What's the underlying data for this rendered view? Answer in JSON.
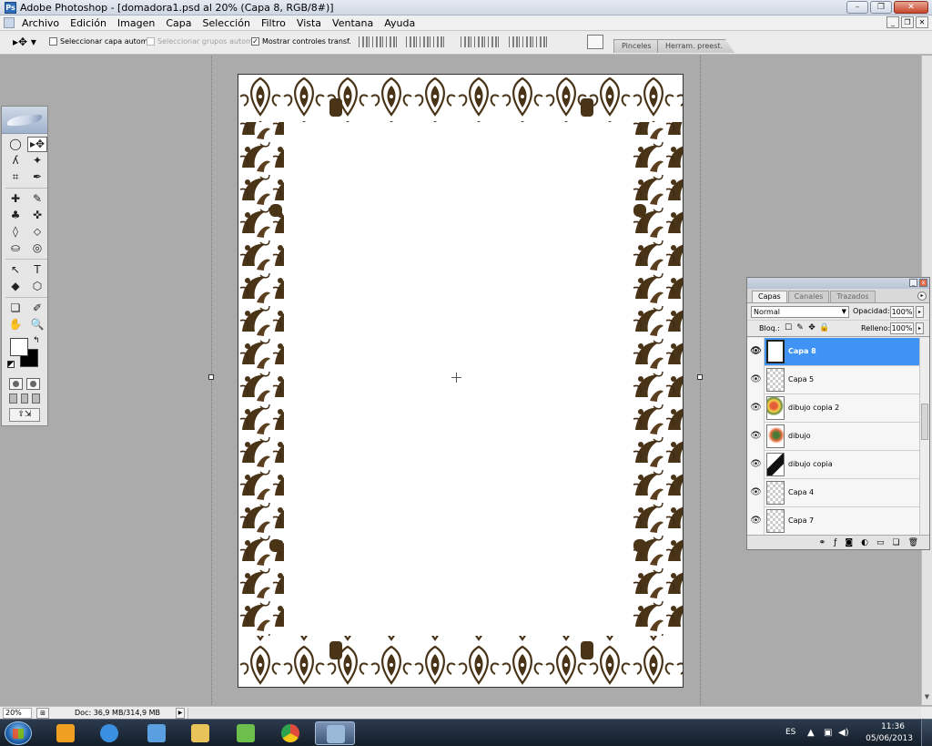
{
  "window": {
    "title": "Adobe Photoshop - [domadora1.psd al 20% (Capa 8, RGB/8#)]",
    "app_icon": "Ps",
    "controls": {
      "minimize": "–",
      "maximize": "❐",
      "close": "✕"
    }
  },
  "menubar": {
    "items": [
      "Archivo",
      "Edición",
      "Imagen",
      "Capa",
      "Selección",
      "Filtro",
      "Vista",
      "Ventana",
      "Ayuda"
    ],
    "doc_controls": {
      "minimize": "_",
      "restore": "❐",
      "close": "✕"
    }
  },
  "options_bar": {
    "tool_glyph": "▸✥ ▾",
    "auto_select_layer": {
      "label": "Seleccionar capa autom.",
      "checked": false
    },
    "auto_select_groups": {
      "label": "Seleccionar grupos autom.",
      "checked": false,
      "disabled": true
    },
    "show_transform_controls": {
      "label": "Mostrar controles transf.",
      "checked": true,
      "mark": "✓"
    },
    "palette_tabs": [
      "Pinceles",
      "Herram. preest."
    ]
  },
  "toolbox": {
    "tools": [
      "◯",
      "▸✥",
      "ʎ",
      "✦",
      "⌗",
      "✒",
      "✚",
      "✎",
      "♣",
      "✜",
      "◊",
      "⬦",
      "⛀",
      "◎",
      "↖",
      "T",
      "◆",
      "⬡",
      "❏",
      "✐",
      "✋",
      "🔍"
    ],
    "swap_glyph": "↰",
    "jump_label": "⇪⇲"
  },
  "layers_panel": {
    "tabs": [
      "Capas",
      "Canales",
      "Trazados"
    ],
    "blend_mode": "Normal",
    "opacity_label": "Opacidad:",
    "opacity": "100%",
    "lock_label": "Bloq.:",
    "lock_icons": [
      "☐",
      "✎",
      "✥",
      "🔒"
    ],
    "fill_label": "Relleno:",
    "fill": "100%",
    "layers": [
      {
        "name": "Capa 8",
        "selected": true,
        "thumb": "white"
      },
      {
        "name": "Capa 5",
        "selected": false,
        "thumb": "transparent"
      },
      {
        "name": "dibujo copia 2",
        "selected": false,
        "thumb": "art"
      },
      {
        "name": "dibujo",
        "selected": false,
        "thumb": "art2"
      },
      {
        "name": "dibujo copia",
        "selected": false,
        "thumb": "dark"
      },
      {
        "name": "Capa 4",
        "selected": false,
        "thumb": "transparent"
      },
      {
        "name": "Capa 7",
        "selected": false,
        "thumb": "transparent"
      }
    ],
    "bottom_icons": [
      "⚭",
      "ƒ",
      "◙",
      "◐",
      "▭",
      "❏",
      "🗑"
    ]
  },
  "status_bar": {
    "zoom": "20%",
    "doc_info": "Doc: 36,9 MB/314,9 MB"
  },
  "taskbar": {
    "apps": [
      {
        "name": "media-player",
        "color": "#f0a020",
        "active": false
      },
      {
        "name": "internet-explorer",
        "color": "#3b8fe0",
        "active": false
      },
      {
        "name": "paint-app",
        "color": "#5aa0e0",
        "active": false
      },
      {
        "name": "file-explorer",
        "color": "#e8c35a",
        "active": false
      },
      {
        "name": "network-app",
        "color": "#6bbf4a",
        "active": false
      },
      {
        "name": "chrome",
        "color": "#e04a3a",
        "active": false
      },
      {
        "name": "photoshop",
        "color": "#9ab8d8",
        "active": true
      }
    ],
    "language": "ES",
    "time": "11:36",
    "date": "05/06/2013"
  },
  "colors": {
    "selection": "#3e93f5",
    "ornament": "#4a3418"
  }
}
